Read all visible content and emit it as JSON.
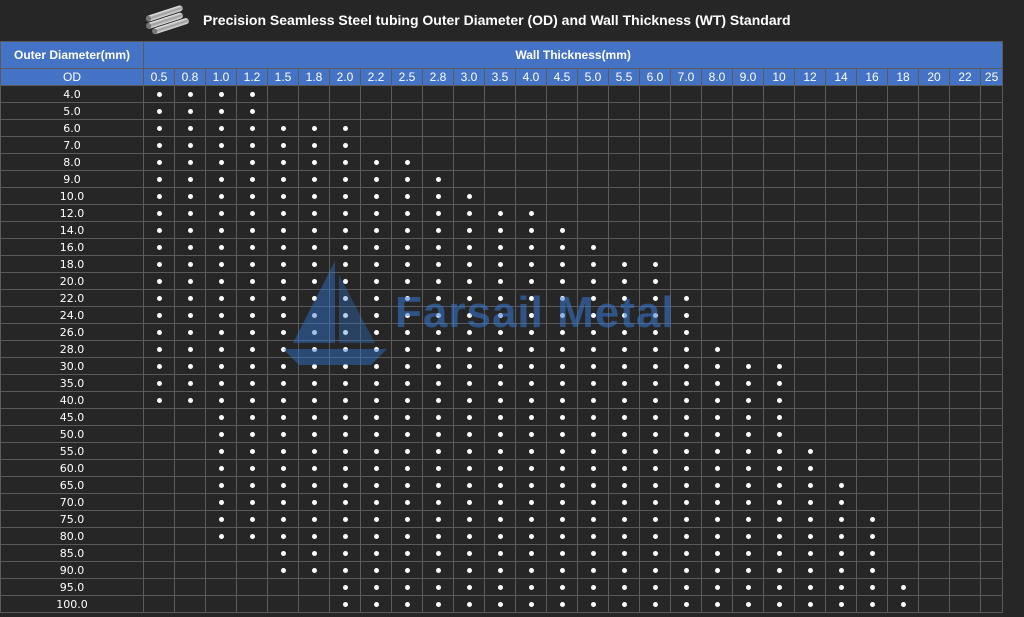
{
  "title": "Precision Seamless Steel tubing Outer Diameter (OD) and Wall Thickness (WT) Standard",
  "watermark": "Farsail Metal",
  "colors": {
    "header_bg": "#4472c4",
    "body_bg": "#262626",
    "grid": "#5a5a5a",
    "text": "#ffffff",
    "watermark": "#3478d2"
  },
  "header": {
    "od_title": "Outer Diameter(mm)",
    "wt_title": "Wall Thickness(mm)",
    "od_label": "OD"
  },
  "wall_thickness": [
    "0.5",
    "0.8",
    "1.0",
    "1.2",
    "1.5",
    "1.8",
    "2.0",
    "2.2",
    "2.5",
    "2.8",
    "3.0",
    "3.5",
    "4.0",
    "4.5",
    "5.0",
    "5.5",
    "6.0",
    "7.0",
    "8.0",
    "9.0",
    "10",
    "12",
    "14",
    "16",
    "18",
    "20",
    "22",
    "25"
  ],
  "rows": [
    {
      "od": "4.0",
      "from": 0,
      "to": 3
    },
    {
      "od": "5.0",
      "from": 0,
      "to": 3
    },
    {
      "od": "6.0",
      "from": 0,
      "to": 6
    },
    {
      "od": "7.0",
      "from": 0,
      "to": 6
    },
    {
      "od": "8.0",
      "from": 0,
      "to": 8
    },
    {
      "od": "9.0",
      "from": 0,
      "to": 9
    },
    {
      "od": "10.0",
      "from": 0,
      "to": 10
    },
    {
      "od": "12.0",
      "from": 0,
      "to": 12
    },
    {
      "od": "14.0",
      "from": 0,
      "to": 13
    },
    {
      "od": "16.0",
      "from": 0,
      "to": 14
    },
    {
      "od": "18.0",
      "from": 0,
      "to": 16
    },
    {
      "od": "20.0",
      "from": 0,
      "to": 16
    },
    {
      "od": "22.0",
      "from": 0,
      "to": 17
    },
    {
      "od": "24.0",
      "from": 0,
      "to": 17
    },
    {
      "od": "26.0",
      "from": 0,
      "to": 17
    },
    {
      "od": "28.0",
      "from": 0,
      "to": 18
    },
    {
      "od": "30.0",
      "from": 0,
      "to": 20
    },
    {
      "od": "35.0",
      "from": 0,
      "to": 20
    },
    {
      "od": "40.0",
      "from": 0,
      "to": 20
    },
    {
      "od": "45.0",
      "from": 2,
      "to": 20
    },
    {
      "od": "50.0",
      "from": 2,
      "to": 20
    },
    {
      "od": "55.0",
      "from": 2,
      "to": 21
    },
    {
      "od": "60.0",
      "from": 2,
      "to": 21
    },
    {
      "od": "65.0",
      "from": 2,
      "to": 22
    },
    {
      "od": "70.0",
      "from": 2,
      "to": 22
    },
    {
      "od": "75.0",
      "from": 2,
      "to": 23
    },
    {
      "od": "80.0",
      "from": 2,
      "to": 23
    },
    {
      "od": "85.0",
      "from": 4,
      "to": 23
    },
    {
      "od": "90.0",
      "from": 4,
      "to": 23
    },
    {
      "od": "95.0",
      "from": 6,
      "to": 24
    },
    {
      "od": "100.0",
      "from": 6,
      "to": 24
    }
  ]
}
